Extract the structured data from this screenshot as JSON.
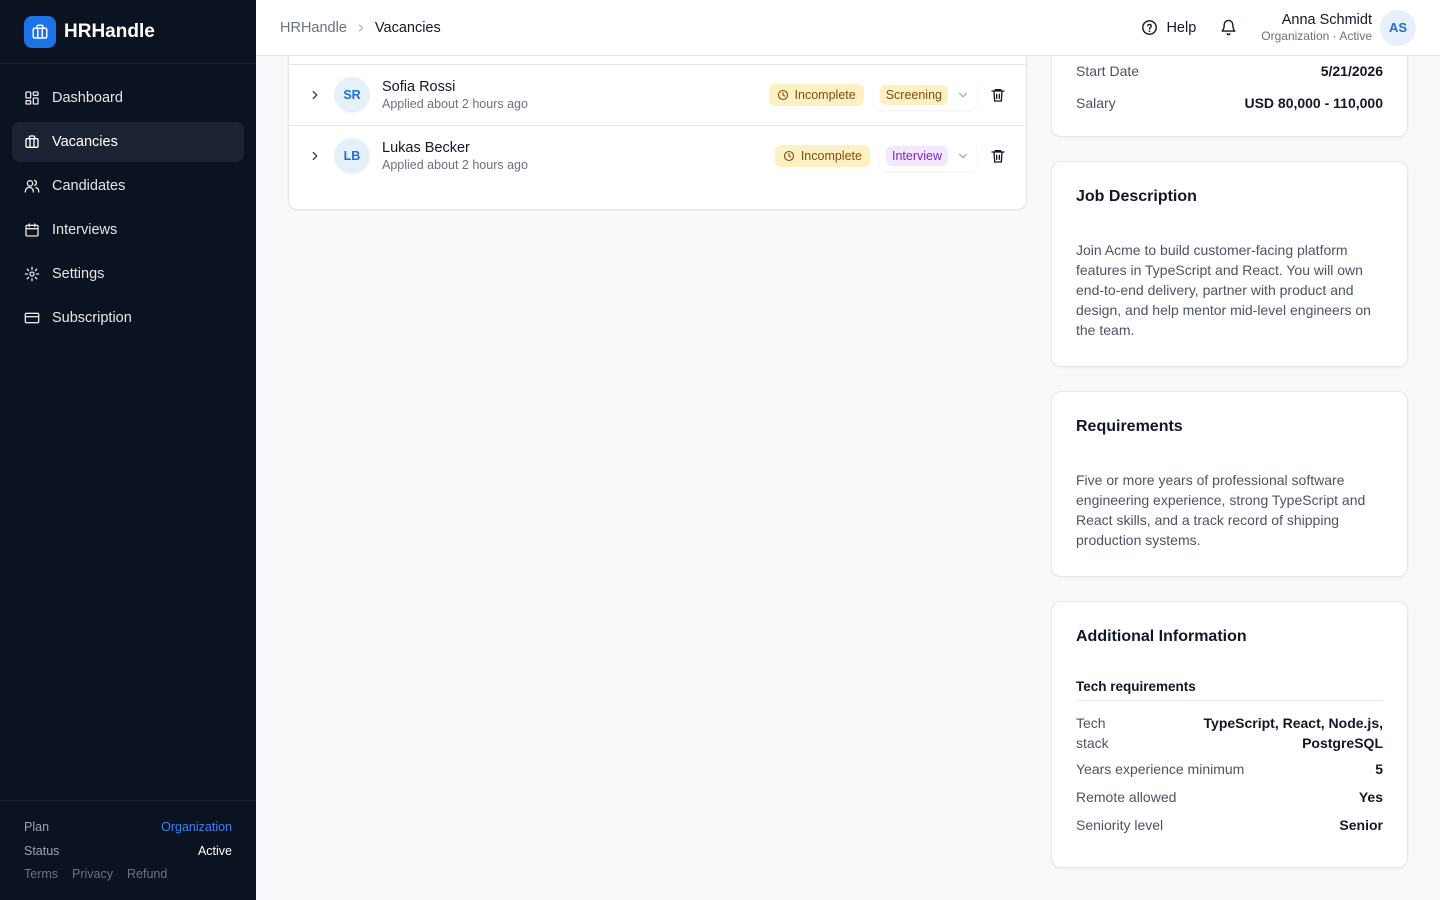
{
  "brand": {
    "name": "HRHandle"
  },
  "sidebar": {
    "items": [
      {
        "label": "Dashboard",
        "icon": "dashboard-icon"
      },
      {
        "label": "Vacancies",
        "icon": "briefcase-icon"
      },
      {
        "label": "Candidates",
        "icon": "users-icon"
      },
      {
        "label": "Interviews",
        "icon": "calendar-icon"
      },
      {
        "label": "Settings",
        "icon": "gear-icon"
      },
      {
        "label": "Subscription",
        "icon": "credit-card-icon"
      }
    ],
    "active": "Vacancies",
    "footer": {
      "plan_label": "Plan",
      "plan_value": "Organization",
      "status_label": "Status",
      "status_value": "Active",
      "links": [
        "Terms",
        "Privacy",
        "Refund"
      ]
    }
  },
  "header": {
    "breadcrumb": [
      "HRHandle",
      "Vacancies"
    ],
    "help_label": "Help",
    "user": {
      "name": "Anna Schmidt",
      "subtitle": "Organization · Active",
      "initials": "AS"
    }
  },
  "candidates": [
    {
      "initials": "SR",
      "name": "Sofia Rossi",
      "applied": "Applied about 2 hours ago",
      "status": "Incomplete",
      "stage": "Screening"
    },
    {
      "initials": "LB",
      "name": "Lukas Becker",
      "applied": "Applied about 2 hours ago",
      "status": "Incomplete",
      "stage": "Interview"
    }
  ],
  "details": {
    "start_date_label": "Start Date",
    "start_date_value": "5/21/2026",
    "salary_label": "Salary",
    "salary_value": "USD 80,000 - 110,000"
  },
  "job_description": {
    "title": "Job Description",
    "text": "Join Acme to build customer-facing platform features in TypeScript and React. You will own end-to-end delivery, partner with product and design, and help mentor mid-level engineers on the team."
  },
  "requirements": {
    "title": "Requirements",
    "text": "Five or more years of professional software engineering experience, strong TypeScript and React skills, and a track record of shipping production systems."
  },
  "additional": {
    "title": "Additional Information",
    "section": "Tech requirements",
    "rows": [
      {
        "label": "Tech stack",
        "value": "TypeScript, React, Node.js, PostgreSQL"
      },
      {
        "label": "Years experience minimum",
        "value": "5"
      },
      {
        "label": "Remote allowed",
        "value": "Yes"
      },
      {
        "label": "Seniority level",
        "value": "Senior"
      }
    ]
  },
  "colors": {
    "sidebar_bg": "#0b1220",
    "accent": "#1d74e7",
    "incomplete_bg": "#fdf1c4",
    "interview_bg": "#f3e8ff"
  }
}
